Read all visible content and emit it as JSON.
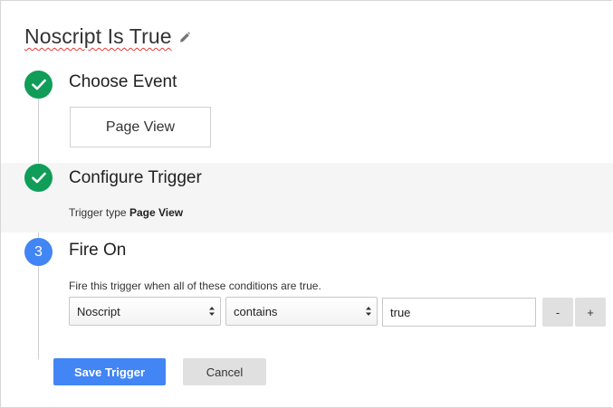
{
  "trigger": {
    "title": "Noscript Is True",
    "edit_icon": "pencil-icon"
  },
  "steps": [
    {
      "status": "done",
      "icon": "check-icon",
      "title": "Choose Event",
      "event": "Page View"
    },
    {
      "status": "done",
      "icon": "check-icon",
      "title": "Configure Trigger",
      "type_label": "Trigger type",
      "type_value": "Page View"
    },
    {
      "status": "current",
      "number": "3",
      "title": "Fire On",
      "condition_text": "Fire this trigger when all of these conditions are true."
    }
  ],
  "condition": {
    "variable": "Noscript",
    "operator": "contains",
    "value": "true",
    "remove_label": "-",
    "add_label": "+"
  },
  "actions": {
    "save_label": "Save Trigger",
    "cancel_label": "Cancel"
  },
  "colors": {
    "done": "#0f9d58",
    "current": "#4285f4",
    "primary": "#4285f4"
  }
}
